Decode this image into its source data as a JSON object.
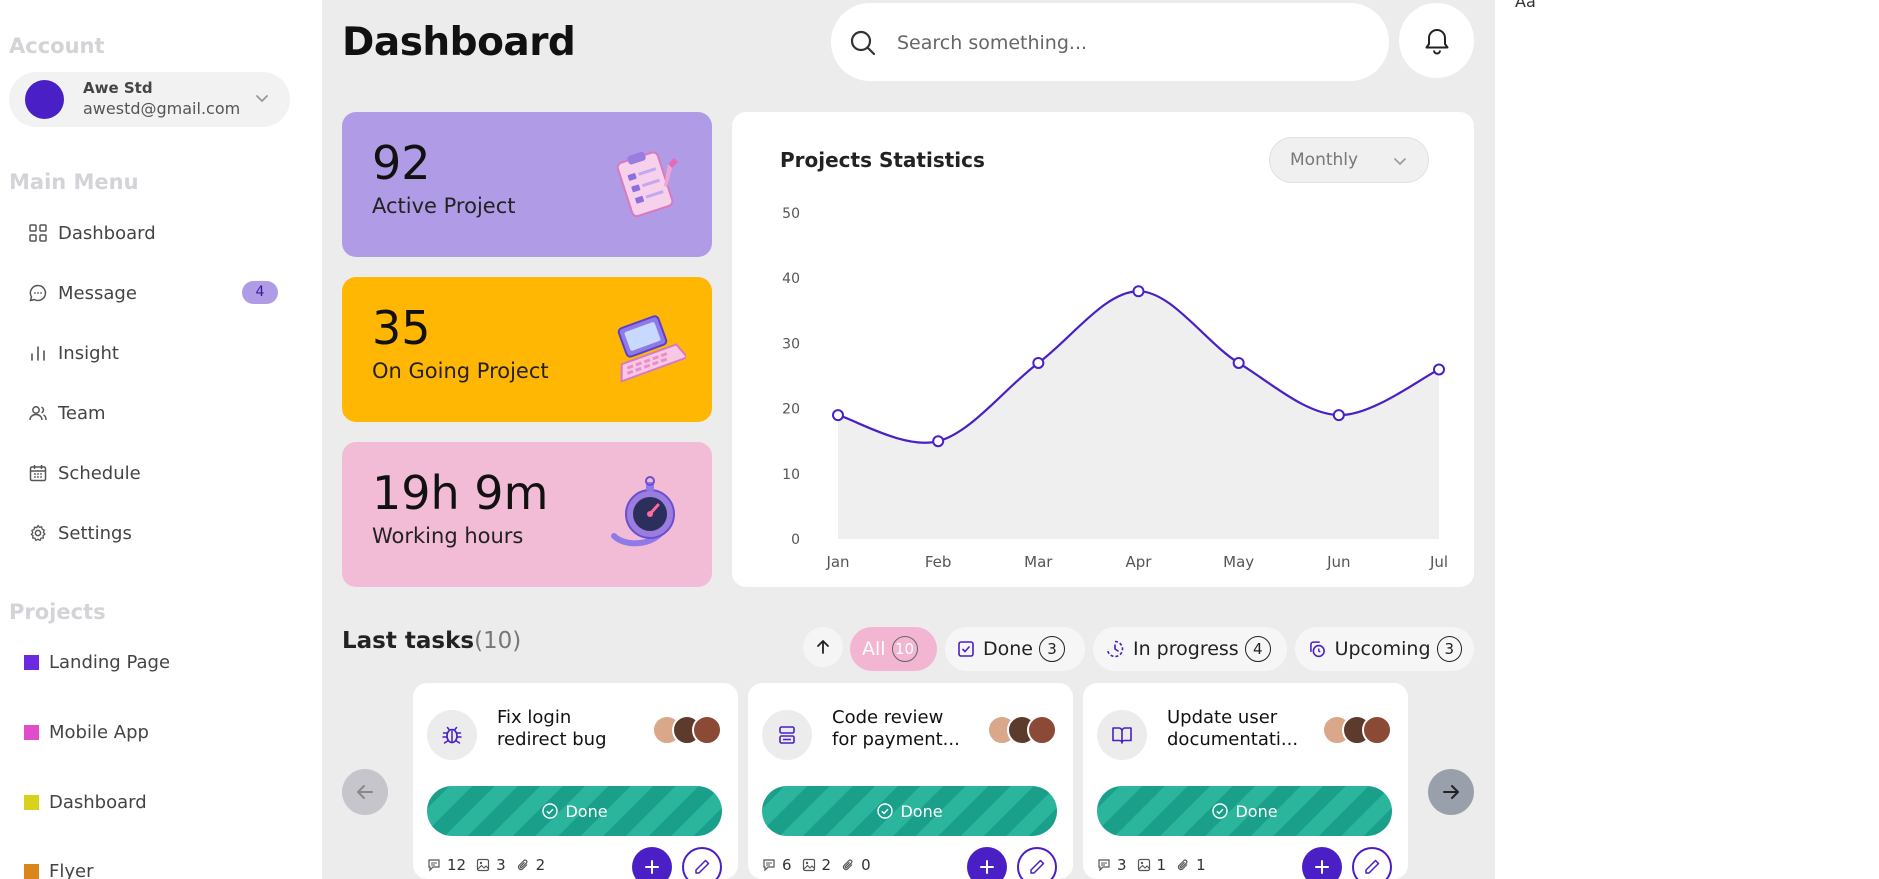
{
  "sidebar": {
    "account_title": "Account",
    "account": {
      "name": "Awe Std",
      "email": "awestd@gmail.com"
    },
    "main_menu_title": "Main Menu",
    "menu": [
      {
        "label": "Dashboard",
        "icon": "grid-icon"
      },
      {
        "label": "Message",
        "icon": "chat-icon",
        "badge": "4"
      },
      {
        "label": "Insight",
        "icon": "bar-chart-icon"
      },
      {
        "label": "Team",
        "icon": "users-icon"
      },
      {
        "label": "Schedule",
        "icon": "calendar-icon"
      },
      {
        "label": "Settings",
        "icon": "gear-icon"
      }
    ],
    "projects_title": "Projects",
    "projects": [
      {
        "label": "Landing Page",
        "color": "#6a2be0"
      },
      {
        "label": "Mobile App",
        "color": "#e04dc8"
      },
      {
        "label": "Dashboard",
        "color": "#d9d21c"
      },
      {
        "label": "Flyer",
        "color": "#d9861c"
      }
    ]
  },
  "header": {
    "title": "Dashboard",
    "search_placeholder": "Search something..."
  },
  "stats": [
    {
      "value": "92",
      "label": "Active Project",
      "color": "#b09be6",
      "icon": "clipboard-icon"
    },
    {
      "value": "35",
      "label": "On Going Project",
      "color": "#ffb703",
      "icon": "laptop-icon"
    },
    {
      "value": "19h 9m",
      "label": "Working hours",
      "color": "#f2bcd7",
      "icon": "stopwatch-icon"
    }
  ],
  "chart": {
    "title": "Projects Statistics",
    "period": "Monthly"
  },
  "chart_data": {
    "type": "line",
    "title": "Projects Statistics",
    "categories": [
      "Jan",
      "Feb",
      "Mar",
      "Apr",
      "May",
      "Jun",
      "Jul"
    ],
    "values": [
      19,
      15,
      27,
      38,
      27,
      19,
      26
    ],
    "ylim": [
      0,
      50
    ],
    "yticks": [
      "0",
      "10",
      "20",
      "30",
      "40",
      "50"
    ],
    "line_color": "#4a1fc6",
    "area_color": "#efefef"
  },
  "tasks": {
    "title": "Last tasks",
    "count": "(10)",
    "filters": [
      {
        "label": "All",
        "count": "10",
        "icon": ""
      },
      {
        "label": "Done",
        "count": "3",
        "icon": "check-square-icon"
      },
      {
        "label": "In progress",
        "count": "4",
        "icon": "progress-clock-icon"
      },
      {
        "label": "Upcoming",
        "count": "3",
        "icon": "upcoming-icon"
      }
    ],
    "cards": [
      {
        "line1": "Fix login",
        "line2": "redirect bug",
        "icon": "bug-icon",
        "status": "Done",
        "comments": "12",
        "images": "3",
        "attachments": "2"
      },
      {
        "line1": "Code review",
        "line2": "for payment...",
        "icon": "server-icon",
        "status": "Done",
        "comments": "6",
        "images": "2",
        "attachments": "0"
      },
      {
        "line1": "Update user",
        "line2": "documentati...",
        "icon": "book-icon",
        "status": "Done",
        "comments": "3",
        "images": "1",
        "attachments": "1"
      }
    ]
  },
  "corner_text": "Aa"
}
